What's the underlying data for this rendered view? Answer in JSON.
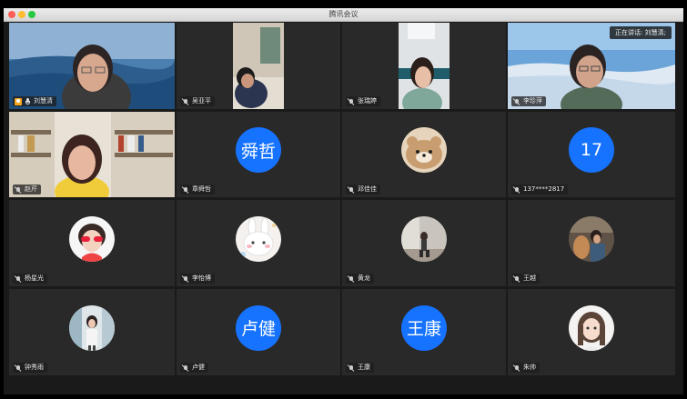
{
  "window": {
    "title": "腾讯会议"
  },
  "speaking": {
    "label": "正在讲话: 刘慧清;"
  },
  "participants": [
    {
      "name": "刘慧清",
      "type": "video"
    },
    {
      "name": "吴亚平",
      "type": "video"
    },
    {
      "name": "张瑞婷",
      "type": "video"
    },
    {
      "name": "李珍萍",
      "type": "video"
    },
    {
      "name": "赵芹",
      "type": "video"
    },
    {
      "name": "章舜哲",
      "type": "text-avatar",
      "avatar_text": "舜哲"
    },
    {
      "name": "邓佳佳",
      "type": "image-avatar"
    },
    {
      "name": "137****2817",
      "type": "text-avatar",
      "avatar_text": "17"
    },
    {
      "name": "杨星光",
      "type": "image-avatar"
    },
    {
      "name": "李怡博",
      "type": "image-avatar"
    },
    {
      "name": "黄龙",
      "type": "image-avatar"
    },
    {
      "name": "王越",
      "type": "image-avatar"
    },
    {
      "name": "钟秀雨",
      "type": "image-avatar"
    },
    {
      "name": "卢健",
      "type": "text-avatar",
      "avatar_text": "卢健"
    },
    {
      "name": "王康",
      "type": "text-avatar",
      "avatar_text": "王康"
    },
    {
      "name": "朱帅",
      "type": "image-avatar"
    }
  ],
  "colors": {
    "avatar_blue": "#1673ff",
    "active_border": "#40c154",
    "tile_bg": "#292929"
  }
}
